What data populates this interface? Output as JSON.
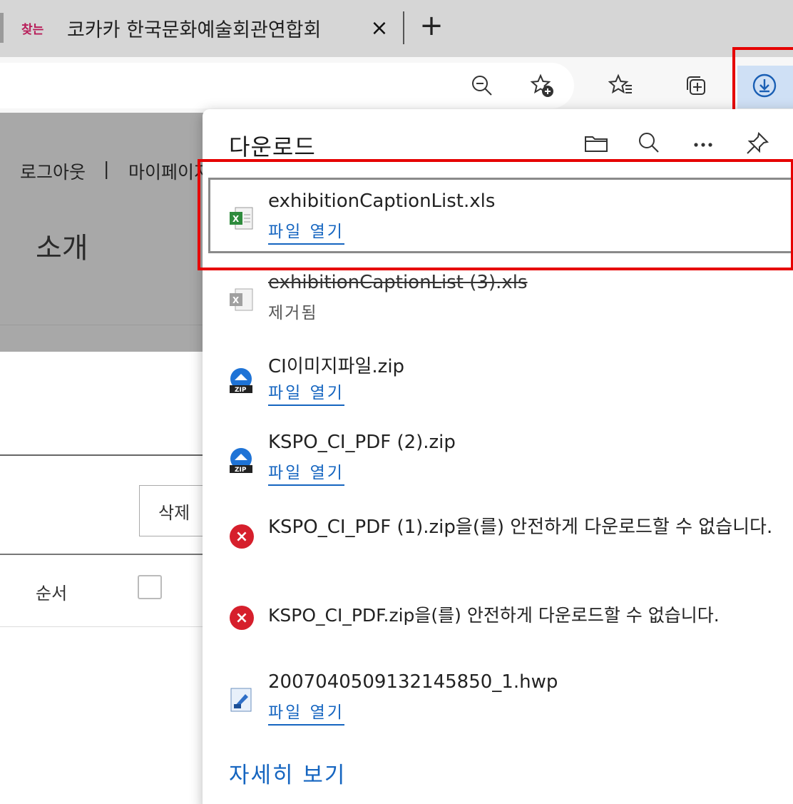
{
  "tab": {
    "favicon_text": "찾는",
    "title": "코카카 한국문화예술회관연합회",
    "close_label": "×",
    "new_tab_label": "+"
  },
  "toolbar": {
    "icons": [
      "zoom-out-icon",
      "add-favorite-icon",
      "favorites-icon",
      "collections-icon",
      "downloads-icon"
    ]
  },
  "page": {
    "nav_logout": "로그아웃",
    "nav_separator": "|",
    "nav_mypage": "마이페이지",
    "heading": "소개",
    "delete_button": "삭제",
    "column_order": "순서"
  },
  "downloads": {
    "title": "다운로드",
    "items": [
      {
        "name": "exhibitionCaptionList.xls",
        "action": "파일 열기",
        "type": "xls",
        "state": "done"
      },
      {
        "name": "exhibitionCaptionList (3).xls",
        "status": "제거됨",
        "type": "xls",
        "state": "removed"
      },
      {
        "name": "CI이미지파일.zip",
        "action": "파일 열기",
        "type": "zip",
        "state": "done"
      },
      {
        "name": "KSPO_CI_PDF (2).zip",
        "action": "파일 열기",
        "type": "zip",
        "state": "done"
      },
      {
        "message": "KSPO_CI_PDF (1).zip을(를) 안전하게 다운로드할 수 없습니다.",
        "type": "error",
        "state": "blocked"
      },
      {
        "message": "KSPO_CI_PDF.zip을(를) 안전하게 다운로드할 수 없습니다.",
        "type": "error",
        "state": "blocked"
      },
      {
        "name": "2007040509132145850_1.hwp",
        "action": "파일 열기",
        "type": "hwp",
        "state": "done"
      }
    ],
    "see_more": "자세히 보기"
  },
  "colors": {
    "accent": "#1565c0",
    "highlight": "#e60000",
    "error": "#d61f2c"
  }
}
